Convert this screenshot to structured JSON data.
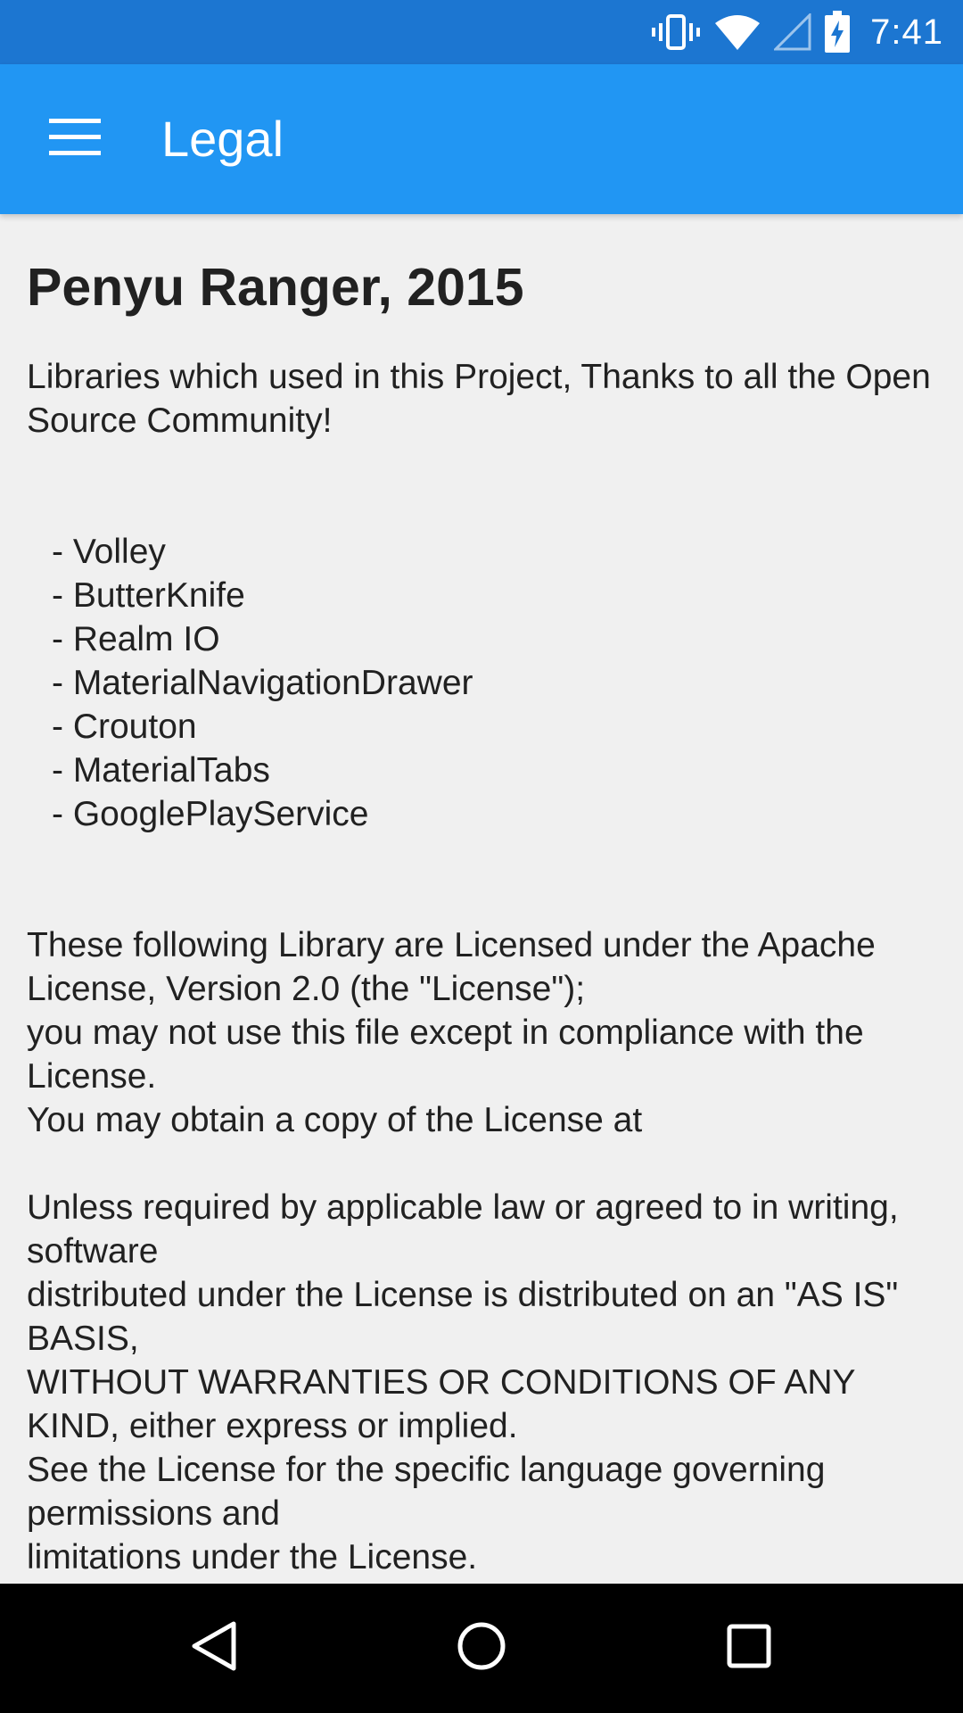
{
  "status_bar": {
    "time": "7:41",
    "icons": [
      "vibrate-icon",
      "wifi-icon",
      "cell-signal-icon",
      "battery-charging-icon"
    ]
  },
  "app_bar": {
    "menu_icon": "hamburger-menu-icon",
    "title": "Legal"
  },
  "content": {
    "heading": "Penyu Ranger, 2015",
    "intro": "Libraries which used in this Project, Thanks to all the Open Source Community!",
    "libraries": [
      "- Volley",
      "- ButterKnife",
      "- Realm IO",
      "- MaterialNavigationDrawer",
      "- Crouton",
      "- MaterialTabs",
      "- GooglePlayService"
    ],
    "license_paragraph_1": [
      "These following Library are Licensed under the Apache License, Version 2.0 (the \"License\");",
      "you may not use this file except in compliance with the License.",
      "You may obtain a copy of the License at"
    ],
    "license_paragraph_2": [
      "Unless required by applicable law or agreed to in writing, software",
      "distributed under the License is distributed on an \"AS IS\" BASIS,",
      "WITHOUT WARRANTIES OR CONDITIONS OF ANY KIND, either express or implied.",
      "See the License for the specific language governing permissions and",
      "limitations under the License."
    ]
  },
  "nav_bar": {
    "icons": [
      "back-icon",
      "home-icon",
      "recents-icon"
    ]
  },
  "colors": {
    "status_bar": "#1c76d1",
    "app_bar": "#2196f3",
    "background": "#f0f0f0",
    "text": "#212121",
    "nav_bar": "#000000"
  }
}
